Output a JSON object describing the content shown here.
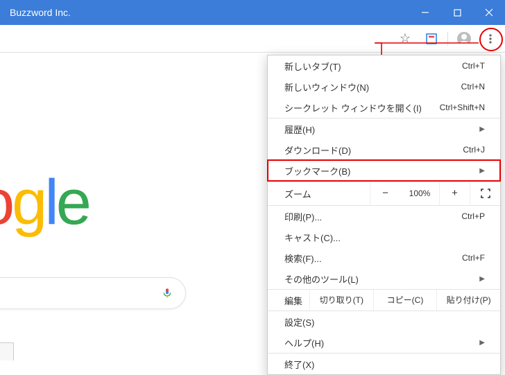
{
  "window": {
    "title": "Buzzword Inc."
  },
  "logo": {
    "letters": [
      "o",
      "g",
      "l",
      "e"
    ]
  },
  "menu": {
    "group1": [
      {
        "label": "新しいタブ(T)",
        "shortcut": "Ctrl+T"
      },
      {
        "label": "新しいウィンドウ(N)",
        "shortcut": "Ctrl+N"
      },
      {
        "label": "シークレット ウィンドウを開く(I)",
        "shortcut": "Ctrl+Shift+N"
      }
    ],
    "group2": [
      {
        "label": "履歴(H)",
        "submenu": true
      },
      {
        "label": "ダウンロード(D)",
        "shortcut": "Ctrl+J"
      },
      {
        "label": "ブックマーク(B)",
        "submenu": true,
        "highlight": true
      }
    ],
    "zoom": {
      "label": "ズーム",
      "value": "100%",
      "minus": "−",
      "plus": "+"
    },
    "group3": [
      {
        "label": "印刷(P)...",
        "shortcut": "Ctrl+P"
      },
      {
        "label": "キャスト(C)..."
      },
      {
        "label": "検索(F)...",
        "shortcut": "Ctrl+F"
      },
      {
        "label": "その他のツール(L)",
        "submenu": true
      }
    ],
    "edit": {
      "label": "編集",
      "cut": "切り取り(T)",
      "copy": "コピー(C)",
      "paste": "貼り付け(P)"
    },
    "group4": [
      {
        "label": "設定(S)"
      },
      {
        "label": "ヘルプ(H)",
        "submenu": true
      }
    ],
    "group5": [
      {
        "label": "終了(X)"
      }
    ]
  }
}
